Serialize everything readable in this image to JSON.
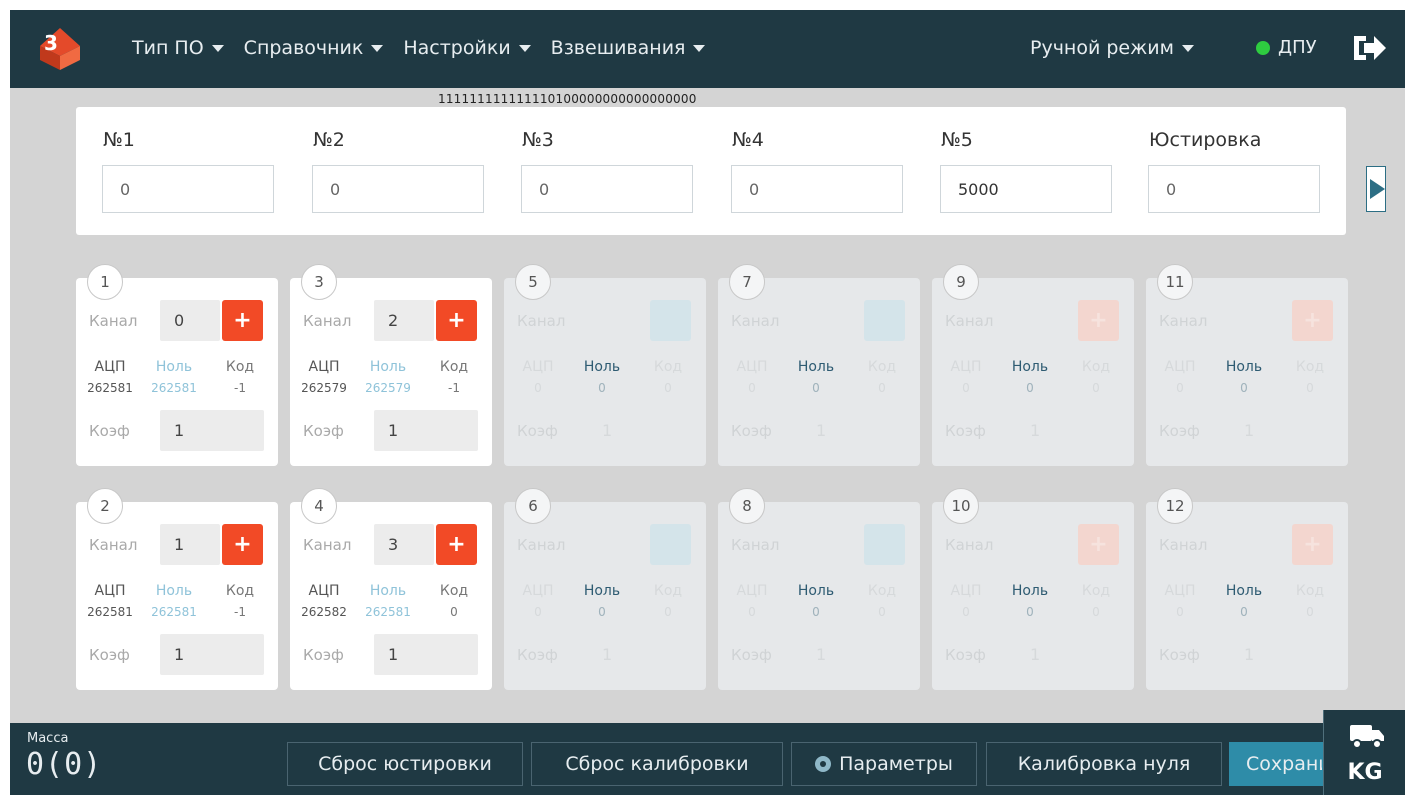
{
  "topbar": {
    "nav": [
      {
        "label": "Тип ПО"
      },
      {
        "label": "Справочник"
      },
      {
        "label": "Настройки"
      },
      {
        "label": "Взвешивания"
      }
    ],
    "mode": "Ручной режим",
    "connection": "ДПУ",
    "connection_color": "#2ecc40"
  },
  "bits": "111111111111110100000000000000000",
  "adjust": [
    {
      "label": "№1",
      "value": "0"
    },
    {
      "label": "№2",
      "value": "0"
    },
    {
      "label": "№3",
      "value": "0"
    },
    {
      "label": "№4",
      "value": "0"
    },
    {
      "label": "№5",
      "value": "5000"
    },
    {
      "label": "Юстировка",
      "value": "0"
    }
  ],
  "labels": {
    "channel": "Канал",
    "adc": "АЦП",
    "zero": "Ноль",
    "code": "Код",
    "coef": "Коэф",
    "add": "+",
    "remove": "–"
  },
  "sensors": [
    {
      "num": "1",
      "channel": "0",
      "adc": "262581",
      "zero": "262581",
      "code": "-1",
      "coef": "1"
    },
    {
      "num": "3",
      "channel": "2",
      "adc": "262579",
      "zero": "262579",
      "code": "-1",
      "coef": "1"
    },
    {
      "num": "5",
      "channel": "",
      "adc": "0",
      "zero": "0",
      "code": "0",
      "coef": "1"
    },
    {
      "num": "7",
      "channel": "",
      "adc": "0",
      "zero": "0",
      "code": "0",
      "coef": "1"
    },
    {
      "num": "9",
      "channel": "",
      "adc": "0",
      "zero": "0",
      "code": "0",
      "coef": "1"
    },
    {
      "num": "11",
      "channel": "",
      "adc": "0",
      "zero": "0",
      "code": "0",
      "coef": "1"
    },
    {
      "num": "2",
      "channel": "1",
      "adc": "262581",
      "zero": "262581",
      "code": "-1",
      "coef": "1"
    },
    {
      "num": "4",
      "channel": "3",
      "adc": "262582",
      "zero": "262581",
      "code": "0",
      "coef": "1"
    },
    {
      "num": "6",
      "channel": "",
      "adc": "0",
      "zero": "0",
      "code": "0",
      "coef": "1"
    },
    {
      "num": "8",
      "channel": "",
      "adc": "0",
      "zero": "0",
      "code": "0",
      "coef": "1"
    },
    {
      "num": "10",
      "channel": "",
      "adc": "0",
      "zero": "0",
      "code": "0",
      "coef": "1"
    },
    {
      "num": "12",
      "channel": "",
      "adc": "0",
      "zero": "0",
      "code": "0",
      "coef": "1"
    }
  ],
  "footer": {
    "mass_label": "Масса",
    "mass_value": "0(0)",
    "reset_adjust": "Сброс юстировки",
    "reset_calib": "Сброс калибровки",
    "params": "Параметры",
    "zero_calib": "Калибровка нуля",
    "save": "Сохранить",
    "unit": "KG"
  },
  "colors": {
    "header": "#1f3943",
    "accent": "#2c6e84",
    "add_button": "#f24a26",
    "save_button": "#2e8ca8"
  }
}
